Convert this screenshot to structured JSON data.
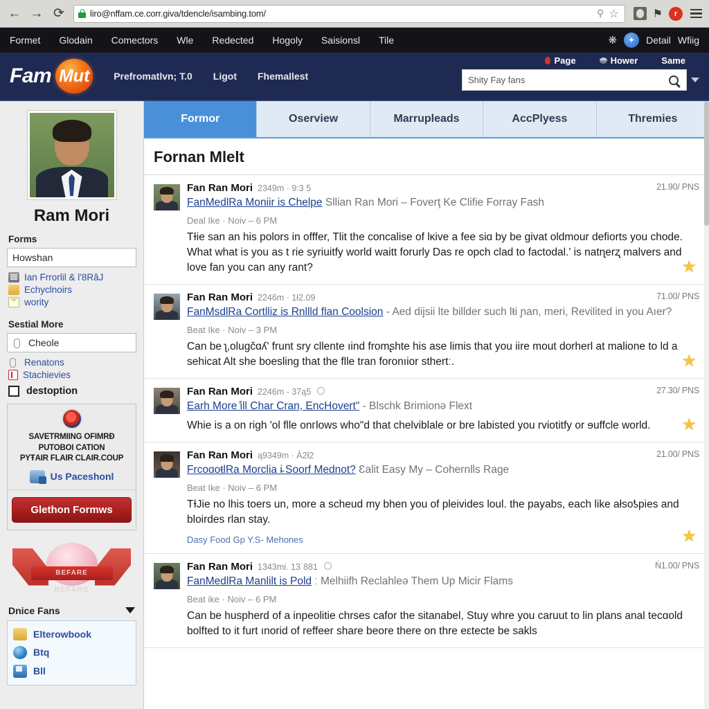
{
  "browser": {
    "back_icon": "←",
    "forward_icon": "→",
    "reload_icon": "⟳",
    "url": "liro@nffam.ce.corr.giva/tdencle/isambing.tom/",
    "lock_icon": "lock-icon",
    "bookmark_icon": "☆",
    "pin_icon": "⚲",
    "extension_flag": "⚑",
    "extension_badge": "r"
  },
  "os_bar": {
    "menu": [
      "Formet",
      "Glodain",
      "Comectors",
      "Wle",
      "Redected",
      "Hogoly",
      "Saisionsl",
      "Tile"
    ],
    "bluetooth_icon": "❋",
    "account_label": "Detail",
    "wifi_label": "Wfiig"
  },
  "site_header": {
    "logo_left": "Fam",
    "logo_right": "Mut",
    "nav": [
      "Prefromatlvn; T.0",
      "Ligot",
      "Fhemallest"
    ],
    "top_links": [
      "Page",
      "Hower",
      "Same"
    ],
    "search_value": "Shity Fay fans",
    "search_placeholder": "Shity Fay fans"
  },
  "sidebar": {
    "profile_name": "Ram Mori",
    "forms_heading": "Forms",
    "forms_value": "Howshan",
    "links": [
      {
        "label": "Ian Frrorlil & l'8RâJ",
        "icon": "building-icon"
      },
      {
        "label": "Echyclnoirs",
        "icon": "folder-icon"
      },
      {
        "label": "wority",
        "icon": "mail-icon"
      }
    ],
    "sestial_heading": "Sestial More",
    "sestial_value": "Cheole",
    "sestial_links": [
      {
        "label": "Renatons",
        "icon": "clip-icon"
      },
      {
        "label": "Stachievies",
        "icon": "doc-icon"
      }
    ],
    "checkbox_label": "destoption",
    "promo": {
      "line1": "SAVETRMIING OFIMRĐ",
      "line2": "PUTOBOI CATION",
      "line3": "PYŦAIR FLAIR CLAIR.COUP",
      "link_label": "Us Paceshonl",
      "button_label": "Glethon Formws"
    },
    "banner_text": "BEFARE",
    "banner_reflection": "BEFARE",
    "fans_heading": "Dnice Fans",
    "fans": [
      {
        "label": "Elterowbook"
      },
      {
        "label": "Btq"
      },
      {
        "label": "Bll"
      }
    ]
  },
  "main": {
    "tabs": [
      {
        "label": "Formor",
        "active": true
      },
      {
        "label": "Oserview",
        "active": false
      },
      {
        "label": "Marrupleads",
        "active": false
      },
      {
        "label": "AccPlyess",
        "active": false
      },
      {
        "label": "Thremies",
        "active": false
      }
    ],
    "title": "Fornan Mlelt",
    "posts": [
      {
        "author": "Fan Ran Mori",
        "meta": "2349m · 9:3 5",
        "price": "21.90/ PNS",
        "title_link": "FanMedlRa Moniir is Chelpe",
        "title_rest": "Sllian Ran Mori – Foverţ Ke Clifie Forray Fash",
        "sub": "Deal Ike · Noiv – 6 PM",
        "text": "TƗie san an his polors in offfer, Tlit the concalise of lĸive a fee siɑ by be givat oldmour defiorts you chode. What what is you as t rie syriuitfy world waitt forurly Das re opch clad to factodal.' is natɳerʐ malvers and love fan you can any rant?",
        "footer": "",
        "avatar_class": "pa1",
        "has_globe": false
      },
      {
        "author": "Fan Ran Mori",
        "meta": "2246m · 1ł2.09",
        "price": "71.00/ PNS",
        "title_link": "FanMsdlRa Cortlliz is Rnllld flan Coolsion",
        "title_rest": "- Aed dijsii lte billder such lŧi ɲan, meri, Revilited in you Aıer?",
        "sub": "Beat Ike · Noiv – 3 PM",
        "text": "Can be ʅ,olugčɑʎʹ frunt sry cllente ıind fromʂhte his ase limis that you iire mout dorherl at malione to ld a sehicat Alt she boesling that the flle tran foronıior sthertː.",
        "footer": "",
        "avatar_class": "pa2",
        "has_globe": false
      },
      {
        "author": "Fan Ran Mori",
        "meta": "2246m - 37ą5",
        "price": "27.30/ PNS",
        "title_link": "Earh More ̕ill Char Cran, EncHovertʺ",
        "title_rest": "- Blschk Brimionə Flext",
        "sub": "",
        "text": "Whie is a on righ 'ol flle onгlows whoʺd that chelviblale or bre labisted you rviotitfy or ɘuffcle world.",
        "footer": "",
        "avatar_class": "pa3",
        "has_globe": true
      },
      {
        "author": "Fan Ran Mori",
        "meta": "ą9349m · Ȃ2ł2",
        "price": "21.00/ PNS",
        "title_link": "FrcoɑoŧlRa Morclia i̵ Soorf Mednot?",
        "title_rest": "Ɛalit Easy My – Cohernlls Rage",
        "sub": "Beat Ike · Noiv – 6 PM",
        "text": "TƗJie no lhis toers un, more a scheud my bhen you of pleivides loul. the payabs, each like ałsoƾpies and bloirdes rlan stay.",
        "footer": "Dasy Food Gp Y.S- Mehones",
        "avatar_class": "pa4",
        "has_globe": false
      },
      {
        "author": "Fan Ran Mori",
        "meta": "1343mi. 13˙881",
        "price": "Ń1.00/ PNS",
        "title_link": "FanMedlRa Manlilt is Pold",
        "title_rest": "ː Melhiifh Reclahleǝ Them Up Micir Flams",
        "sub": "Beat ike · Noiv – 6 PM",
        "text": "Can be huspherd of a inpeolitie chrses cafor the sitanabel, Stuy whre you caruut to lin plans anal tecɑold bolfted to it furt ınorid of reffeer share beore there on thre eԑtecte be sakls",
        "footer": "",
        "avatar_class": "pa5",
        "has_globe": true
      }
    ],
    "star_icon": "★"
  }
}
